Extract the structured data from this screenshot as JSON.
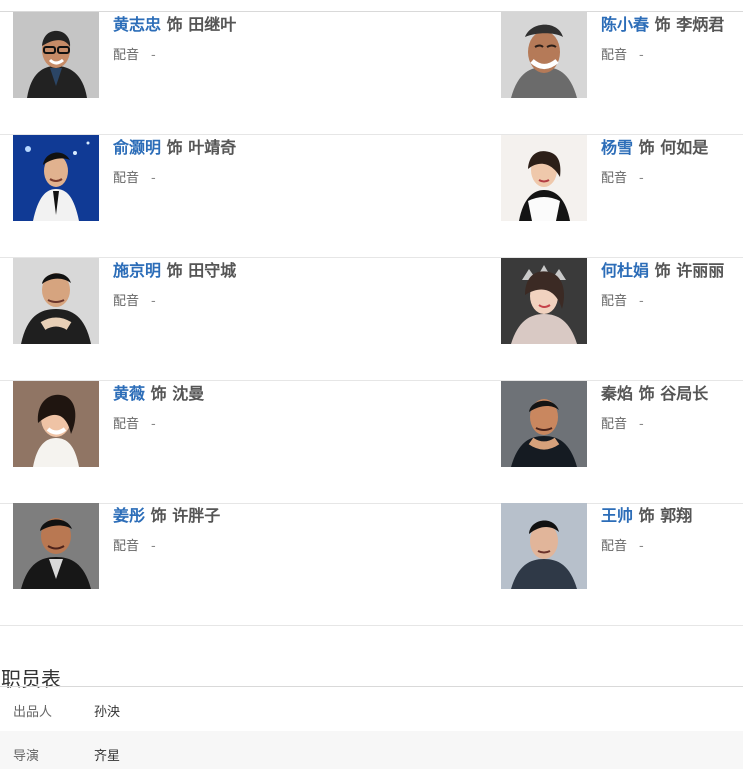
{
  "cast": {
    "role_separator": "饰",
    "voice_label": "配音",
    "voice_value": "-",
    "rows": [
      {
        "left": {
          "actor": "黄志忠",
          "role": "田继叶",
          "linked": true,
          "photo": "dark-jacket"
        },
        "right": {
          "actor": "陈小春",
          "role": "李炳君",
          "linked": true,
          "photo": "gray-shirt"
        }
      },
      {
        "left": {
          "actor": "俞灏明",
          "role": "叶靖奇",
          "linked": true,
          "photo": "blue-stage"
        },
        "right": {
          "actor": "杨雪",
          "role": "何如是",
          "linked": true,
          "photo": "light-studio"
        }
      },
      {
        "left": {
          "actor": "施京明",
          "role": "田守城",
          "linked": true,
          "photo": "gray-suit"
        },
        "right": {
          "actor": "何杜娟",
          "role": "许丽丽",
          "linked": true,
          "photo": "dark-crown"
        }
      },
      {
        "left": {
          "actor": "黄薇",
          "role": "沈曼",
          "linked": true,
          "photo": "warm-smile"
        },
        "right": {
          "actor": "秦焰",
          "role": "谷局长",
          "linked": false,
          "photo": "navy-jacket"
        }
      },
      {
        "left": {
          "actor": "姜彤",
          "role": "许胖子",
          "linked": true,
          "photo": "black-suit"
        },
        "right": {
          "actor": "王帅",
          "role": "郭翔",
          "linked": true,
          "photo": "blue-gray"
        }
      }
    ]
  },
  "staff": {
    "title": "职员表",
    "rows": [
      {
        "label": "出品人",
        "value": "孙泱"
      },
      {
        "label": "导演",
        "value": "齐星"
      }
    ]
  }
}
